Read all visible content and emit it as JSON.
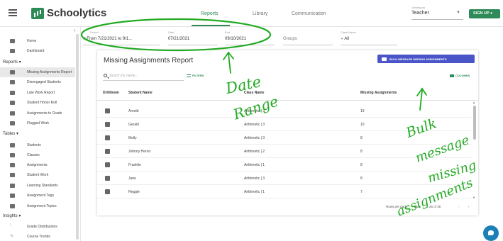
{
  "app": {
    "title": "Schoolytics",
    "nav": [
      "Reports",
      "Library",
      "Communication"
    ],
    "role_label": "Viewing as",
    "role": "Teacher",
    "signup": "SIGN UP"
  },
  "sidebar": {
    "items_top": [
      "Home",
      "Dashboard"
    ],
    "reports_label": "Reports",
    "reports": [
      "Missing Assignments Report",
      "Disengaged Students",
      "Late Work Report",
      "Student Honor Roll",
      "Assignments to Grade",
      "Flagged Work"
    ],
    "tables_label": "Tables",
    "tables": [
      "Students",
      "Classes",
      "Assignments",
      "Student Work",
      "Learning Standards",
      "Assignment Tags",
      "Assignment Topics"
    ],
    "insights_label": "Insights",
    "insights": [
      "Grade Distributions",
      "Course Trends"
    ]
  },
  "filters": {
    "period_label": "Period",
    "period_value": "From 7/21/2021 to 9/1...",
    "start_label": "Start",
    "start_value": "07/21/2021",
    "end_label": "End",
    "end_value": "09/10/2021",
    "groups_value": "Groups",
    "classname_label": "Class Name",
    "classname_value": "All"
  },
  "report": {
    "title": "Missing Assignments Report",
    "bulk_button": "BULK MESSAGE MISSING ASSIGNMENTS",
    "search_placeholder": "Search by name...",
    "filters_label": "FILTERS",
    "columns_label": "COLUMNS",
    "headers": {
      "drilldown": "Drilldown",
      "student_name": "Student Name",
      "class_name": "Class Name",
      "missing": "Missing Assignments"
    },
    "rows": [
      {
        "name": "Arnold",
        "class": "Arithmetic | 3",
        "missing": "19"
      },
      {
        "name": "Gerald",
        "class": "Arithmetic | 3",
        "missing": "10"
      },
      {
        "name": "Molly",
        "class": "Arithmetic | 3",
        "missing": "8"
      },
      {
        "name": "Johnny Heron",
        "class": "Arithmetic | 2",
        "missing": "8"
      },
      {
        "name": "Franklin",
        "class": "Arithmetic | 1",
        "missing": "8"
      },
      {
        "name": "Jane",
        "class": "Arithmetic | 3",
        "missing": "8"
      },
      {
        "name": "Reggie",
        "class": "Arithmetic | 1",
        "missing": "7"
      }
    ],
    "rows_per_page_label": "Rows per page:",
    "rows_per_page": "25",
    "page_range": "1-25 of 35"
  },
  "annotations": {
    "date": "Date",
    "range": "Range",
    "bulk": "Bulk",
    "message": "message",
    "missing": "missing",
    "assignments": "assignments",
    "color": "#22aa22"
  },
  "colors": {
    "brand": "#2e8b57",
    "bulk_button": "#4a55c7",
    "chat": "#1a80b6"
  }
}
